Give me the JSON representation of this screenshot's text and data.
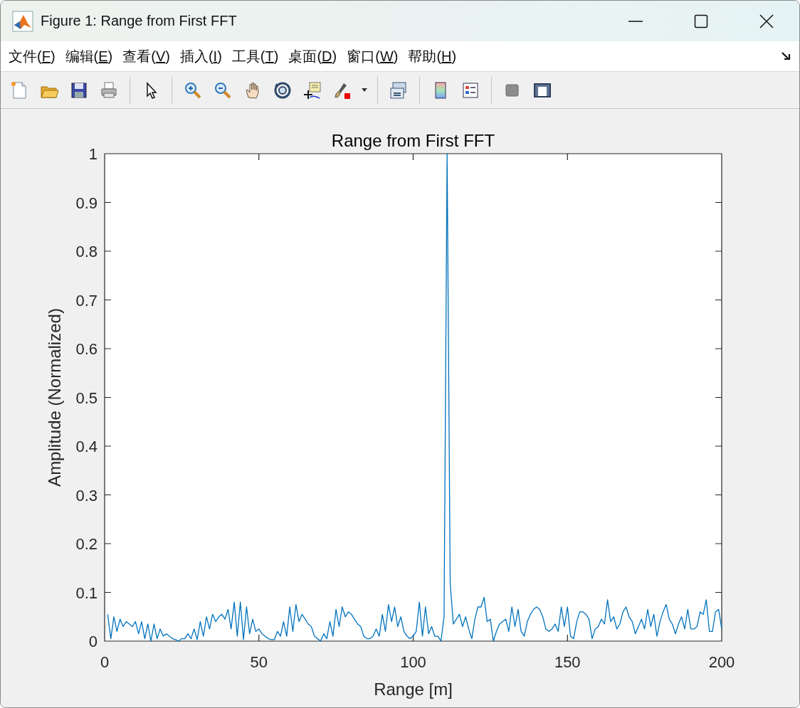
{
  "window": {
    "title": "Figure 1: Range from First FFT"
  },
  "menu": [
    {
      "label": "文件(F)"
    },
    {
      "label": "编辑(E)"
    },
    {
      "label": "查看(V)"
    },
    {
      "label": "插入(I)"
    },
    {
      "label": "工具(T)"
    },
    {
      "label": "桌面(D)"
    },
    {
      "label": "窗口(W)"
    },
    {
      "label": "帮助(H)"
    }
  ],
  "figure": {
    "chart_data": {
      "type": "line",
      "title": "Range from First FFT",
      "xlabel": "Range [m]",
      "ylabel": "Amplitude (Normalized)",
      "x": [
        1,
        2,
        3,
        4,
        5,
        6,
        7,
        8,
        9,
        10,
        11,
        12,
        13,
        14,
        15,
        16,
        17,
        18,
        19,
        20,
        21,
        22,
        23,
        24,
        25,
        26,
        27,
        28,
        29,
        30,
        31,
        32,
        33,
        34,
        35,
        36,
        37,
        38,
        39,
        40,
        41,
        42,
        43,
        44,
        45,
        46,
        47,
        48,
        49,
        50,
        51,
        52,
        53,
        54,
        55,
        56,
        57,
        58,
        59,
        60,
        61,
        62,
        63,
        64,
        65,
        66,
        67,
        68,
        69,
        70,
        71,
        72,
        73,
        74,
        75,
        76,
        77,
        78,
        79,
        80,
        81,
        82,
        83,
        84,
        85,
        86,
        87,
        88,
        89,
        90,
        91,
        92,
        93,
        94,
        95,
        96,
        97,
        98,
        99,
        100,
        101,
        102,
        103,
        104,
        105,
        106,
        107,
        108,
        109,
        110,
        111,
        112,
        113,
        114,
        115,
        116,
        117,
        118,
        119,
        120,
        121,
        122,
        123,
        124,
        125,
        126,
        127,
        128,
        129,
        130,
        131,
        132,
        133,
        134,
        135,
        136,
        137,
        138,
        139,
        140,
        141,
        142,
        143,
        144,
        145,
        146,
        147,
        148,
        149,
        150,
        151,
        152,
        153,
        154,
        155,
        156,
        157,
        158,
        159,
        160,
        161,
        162,
        163,
        164,
        165,
        166,
        167,
        168,
        169,
        170,
        171,
        172,
        173,
        174,
        175,
        176,
        177,
        178,
        179,
        180,
        181,
        182,
        183,
        184,
        185,
        186,
        187,
        188,
        189,
        190,
        191,
        192,
        193,
        194,
        195,
        196,
        197,
        198,
        199,
        200
      ],
      "series": [
        {
          "color": "#0072bd",
          "values": [
            0.055,
            0.005,
            0.05,
            0.02,
            0.045,
            0.03,
            0.04,
            0.035,
            0.03,
            0.04,
            0.015,
            0.04,
            0.005,
            0.035,
            0.0,
            0.035,
            0.005,
            0.025,
            0.01,
            0.015,
            0.01,
            0.005,
            0.003,
            0.0,
            0.005,
            0.005,
            0.015,
            0.005,
            0.025,
            0.003,
            0.04,
            0.01,
            0.05,
            0.025,
            0.055,
            0.04,
            0.05,
            0.055,
            0.045,
            0.065,
            0.025,
            0.08,
            0.01,
            0.08,
            0.003,
            0.07,
            0.015,
            0.045,
            0.02,
            0.025,
            0.015,
            0.01,
            0.005,
            0.003,
            0.003,
            0.02,
            0.01,
            0.04,
            0.01,
            0.07,
            0.02,
            0.075,
            0.04,
            0.055,
            0.045,
            0.035,
            0.03,
            0.01,
            0.005,
            0.0,
            0.015,
            0.005,
            0.04,
            0.01,
            0.065,
            0.03,
            0.07,
            0.05,
            0.06,
            0.055,
            0.045,
            0.035,
            0.03,
            0.01,
            0.005,
            0.005,
            0.01,
            0.025,
            0.01,
            0.055,
            0.02,
            0.075,
            0.04,
            0.07,
            0.03,
            0.05,
            0.02,
            0.01,
            0.005,
            0.01,
            0.02,
            0.08,
            0.01,
            0.07,
            0.015,
            0.03,
            0.01,
            0.01,
            0.0,
            0.05,
            1.0,
            0.12,
            0.035,
            0.045,
            0.055,
            0.03,
            0.05,
            0.025,
            0.005,
            0.045,
            0.07,
            0.07,
            0.09,
            0.04,
            0.045,
            0.0,
            0.02,
            0.035,
            0.04,
            0.045,
            0.02,
            0.07,
            0.03,
            0.065,
            0.02,
            0.01,
            0.04,
            0.055,
            0.065,
            0.07,
            0.065,
            0.05,
            0.025,
            0.02,
            0.025,
            0.035,
            0.02,
            0.07,
            0.03,
            0.07,
            0.01,
            0.005,
            0.04,
            0.06,
            0.06,
            0.055,
            0.045,
            0.005,
            0.025,
            0.03,
            0.045,
            0.035,
            0.085,
            0.04,
            0.05,
            0.025,
            0.035,
            0.06,
            0.07,
            0.05,
            0.04,
            0.015,
            0.03,
            0.045,
            0.025,
            0.065,
            0.03,
            0.055,
            0.01,
            0.04,
            0.06,
            0.075,
            0.045,
            0.035,
            0.015,
            0.035,
            0.05,
            0.025,
            0.065,
            0.025,
            0.025,
            0.03,
            0.06,
            0.055,
            0.085,
            0.02,
            0.02,
            0.06,
            0.065,
            0.025
          ]
        }
      ],
      "xlim": [
        0,
        200
      ],
      "ylim": [
        0,
        1
      ],
      "xticks": [
        0,
        50,
        100,
        150,
        200
      ],
      "yticks": [
        0,
        0.1,
        0.2,
        0.3,
        0.4,
        0.5,
        0.6,
        0.7,
        0.8,
        0.9,
        1
      ]
    }
  }
}
